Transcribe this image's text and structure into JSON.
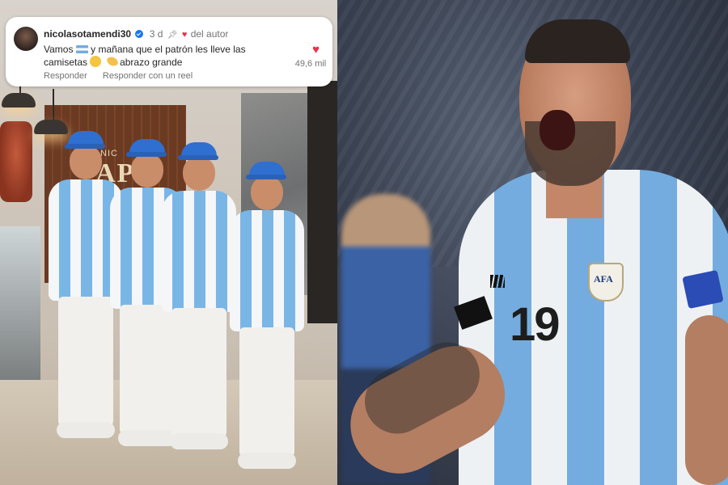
{
  "comment": {
    "username": "nicolasotamendi30",
    "age": "3 d",
    "liked_by_author": "del autor",
    "text_part1": "Vamos",
    "text_part2": "y mañana que el patrón les lleve las camisetas",
    "text_part3": "abrazo grande",
    "like_count": "49,6 mil",
    "actions": {
      "reply": "Responder",
      "reply_with_reel": "Responder con un reel"
    }
  },
  "left_photo": {
    "sign_text": "AP",
    "sign_small": "NIC"
  },
  "right_photo": {
    "shirt_number": "19",
    "crest_text": "AFA"
  },
  "icons": {
    "verified": "verified-badge-icon",
    "pin": "pin-icon",
    "heart": "heart-icon",
    "flag": "argentina-flag-icon"
  },
  "colors": {
    "heart": "#ed2f49",
    "verified": "#1877f2",
    "jersey_blue": "#74acdf"
  }
}
